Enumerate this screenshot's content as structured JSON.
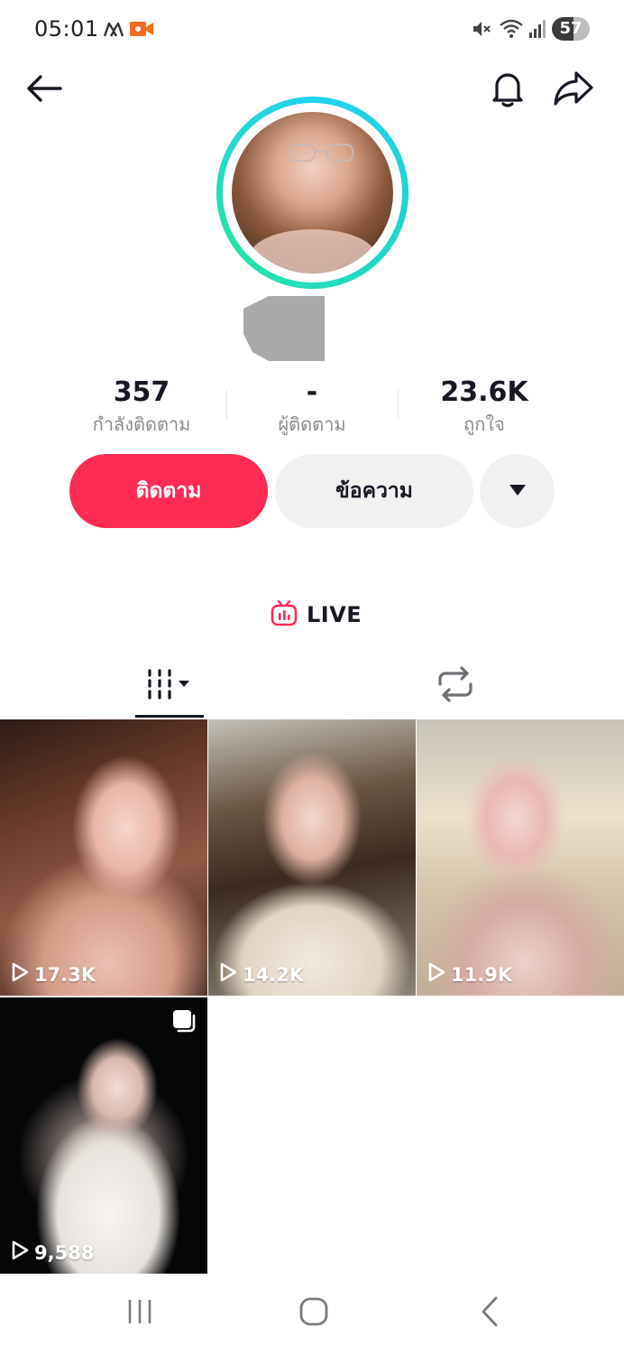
{
  "status_bar": {
    "time": "05:01",
    "battery": "57",
    "battery_level_percent": 57,
    "icons": [
      "app-notification-icon",
      "video-record-icon",
      "mute-icon",
      "wifi-icon",
      "signal-icon",
      "battery-icon"
    ]
  },
  "top_bar": {
    "icons": [
      "back-arrow-icon",
      "bell-icon",
      "share-icon"
    ]
  },
  "profile": {
    "ring_colors": [
      "#23d0f0",
      "#25e3a8"
    ]
  },
  "stats": [
    {
      "value": "357",
      "label": "กำลังติดตาม"
    },
    {
      "value": "-",
      "label": "ผู้ติดตาม"
    },
    {
      "value": "23.6K",
      "label": "ถูกใจ"
    }
  ],
  "actions": {
    "follow_label": "ติดตาม",
    "message_label": "ข้อความ",
    "follow_color": "#fe2c55"
  },
  "live": {
    "label": "LIVE",
    "icon_color": "#fe2c55"
  },
  "tabs": [
    {
      "icon": "videos-grid-icon",
      "selected": true
    },
    {
      "icon": "repost-icon",
      "selected": false
    }
  ],
  "videos": [
    {
      "views": "17.3K"
    },
    {
      "views": "14.2K"
    },
    {
      "views": "11.9K"
    },
    {
      "views": "9,588",
      "is_multi": true
    }
  ],
  "nav_bar": {
    "icons": [
      "recent-apps-icon",
      "home-icon",
      "back-icon"
    ]
  }
}
